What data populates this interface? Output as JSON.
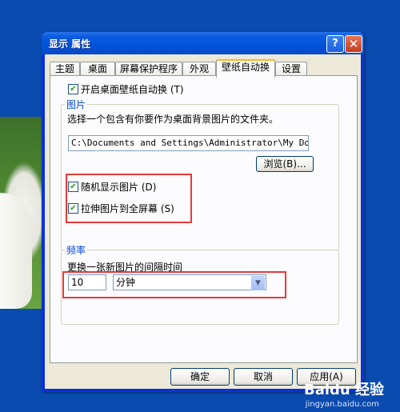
{
  "window": {
    "title": "显示 属性",
    "help_label": "?",
    "close_label": "✕"
  },
  "tabs": [
    {
      "label": "主题"
    },
    {
      "label": "桌面"
    },
    {
      "label": "屏幕保护程序"
    },
    {
      "label": "外观"
    },
    {
      "label": "壁纸自动换",
      "active": true
    },
    {
      "label": "设置"
    }
  ],
  "panel": {
    "enable_auto_change": {
      "checked": true,
      "label": "开启桌面壁纸自动换 (T)"
    },
    "picture_group": {
      "title": "图片",
      "description": "选择一个包含有你要作为桌面背景图片的文件夹。",
      "folder_path": "C:\\Documents and Settings\\Administrator\\My Docume",
      "browse_label": "浏览(B)..."
    },
    "random_display": {
      "checked": true,
      "label": "随机显示图片 (D)"
    },
    "stretch_fullscreen": {
      "checked": true,
      "label": "拉伸图片到全屏幕 (S)"
    },
    "frequency_group": {
      "title": "频率",
      "description": "更换一张新图片的间隔时间",
      "interval_value": "10",
      "interval_unit": "分钟"
    }
  },
  "buttons": {
    "ok": "确定",
    "cancel": "取消",
    "apply": "应用(A)"
  },
  "check_mark": "✔",
  "dropdown_arrow": "▼",
  "watermark": {
    "top": "Baidu 经验",
    "bottom": "jingyan.baidu.com"
  }
}
